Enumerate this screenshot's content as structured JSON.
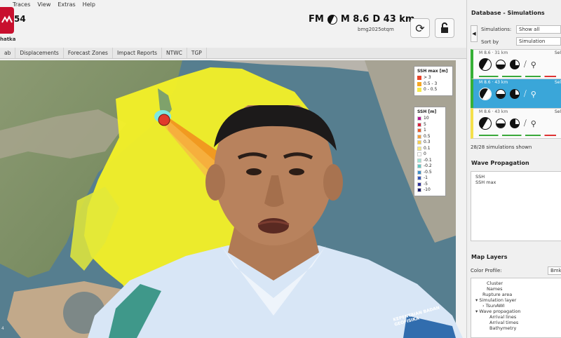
{
  "menu": [
    "Traces",
    "View",
    "Extras",
    "Help"
  ],
  "header": {
    "event_number": "54",
    "region": "hatka",
    "fm_label": "FM",
    "magnitude": "M 8.6",
    "depth": "D 43 km",
    "event_id": "bmg2025otqm"
  },
  "tabs": [
    "ab",
    "Displacements",
    "Forecast Zones",
    "Impact Reports",
    "NTWC",
    "TGP"
  ],
  "legend_ssh_max": {
    "title": "SSH max [m]",
    "rows": [
      {
        "label": "> 3",
        "color": "#e8452a"
      },
      {
        "label": "0.5 - 3",
        "color": "#f5a623"
      },
      {
        "label": "0 - 0.5",
        "color": "#f5e94a"
      }
    ]
  },
  "legend_ssh": {
    "title": "SSH [m]",
    "rows": [
      {
        "label": "10",
        "color": "#b5138f"
      },
      {
        "label": "5",
        "color": "#d8203a"
      },
      {
        "label": "1",
        "color": "#ea5a2a"
      },
      {
        "label": "0.5",
        "color": "#f3a03a"
      },
      {
        "label": "0.3",
        "color": "#f7cf4a"
      },
      {
        "label": "0.1",
        "color": "#f7ec7a"
      },
      {
        "label": "0",
        "color": "#ffffff"
      },
      {
        "label": "-0.1",
        "color": "#9fe5d8"
      },
      {
        "label": "-0.2",
        "color": "#5fc9c3"
      },
      {
        "label": "-0.5",
        "color": "#3b8fc9"
      },
      {
        "label": "-1",
        "color": "#3655b8"
      },
      {
        "label": "-5",
        "color": "#2b2f9a"
      },
      {
        "label": "-10",
        "color": "#1a1a6a"
      }
    ]
  },
  "map_credit": "4",
  "shirt_badge": "KEPENTAIAN BADAN GEOFISIKA",
  "right_panel": {
    "title": "Database - Simulations",
    "simulations_label": "Simulations:",
    "simulations_value": "Show all",
    "sort_label": "Sort by",
    "sort_value": "Simulation",
    "cards": [
      {
        "header": "M 8.6 · 31 km",
        "side": "Sel"
      },
      {
        "header": "M 8.6 · 43 km",
        "side": "Sel"
      },
      {
        "header": "M 8.6 · 43 km",
        "side": "Sel"
      }
    ],
    "sim_count": "28/28 simulations shown",
    "wave_title": "Wave Propagation",
    "wave_items": [
      "SSH",
      "SSH max"
    ],
    "layers_title": "Map Layers",
    "color_profile_label": "Color Profile:",
    "color_profile_value": "Bmk",
    "layer_items": [
      "Cluster",
      "Names",
      "Rupture area",
      "Simulation layer",
      "TsunAWI",
      "Wave propagation",
      "Arrival lines",
      "Arrival times",
      "Bathymetry"
    ]
  },
  "colors": {
    "cyan_highlight": "#3aa6d9",
    "green_marker": "#36b036",
    "yellow_marker": "#f5e04a",
    "ssh_yellow": "#f4f127",
    "ssh_orange": "#f28c1e",
    "epicenter": "#e03b2b"
  }
}
